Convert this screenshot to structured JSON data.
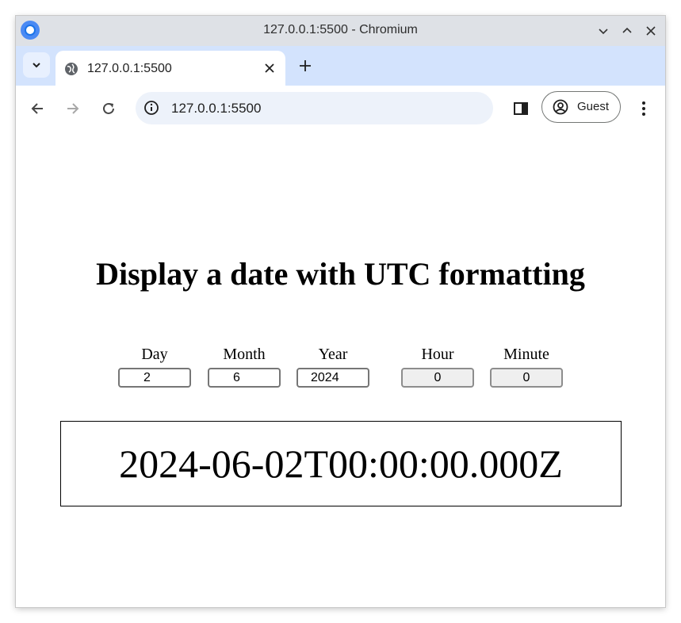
{
  "window": {
    "title": "127.0.0.1:5500 - Chromium"
  },
  "tabs": [
    {
      "label": "127.0.0.1:5500"
    }
  ],
  "address_bar": {
    "url": "127.0.0.1:5500"
  },
  "profile": {
    "label": "Guest"
  },
  "page": {
    "title": "Display a date with UTC formatting",
    "fields": {
      "day": {
        "label": "Day",
        "value": "2"
      },
      "month": {
        "label": "Month",
        "value": "6"
      },
      "year": {
        "label": "Year",
        "value": "2024"
      },
      "hour": {
        "label": "Hour",
        "value": "0"
      },
      "minute": {
        "label": "Minute",
        "value": "0"
      }
    },
    "result": "2024-06-02T00:00:00.000Z"
  },
  "icons": {
    "app": "chromium-logo-icon",
    "tab_search": "chevron-down-icon",
    "favicon": "globe-icon",
    "tab_close": "close-icon",
    "new_tab": "plus-icon",
    "back": "arrow-left-icon",
    "forward": "arrow-right-icon",
    "reload": "reload-icon",
    "site_info": "info-icon",
    "side_panel": "side-panel-icon",
    "profile": "account-circle-icon",
    "menu": "kebab-menu-icon",
    "minimize": "minimize-icon",
    "maximize": "maximize-icon",
    "close_window": "close-icon"
  },
  "colors": {
    "titlebar": "#dee1e6",
    "tabbar": "#d3e3fd",
    "omnibox": "#edf2fa"
  }
}
